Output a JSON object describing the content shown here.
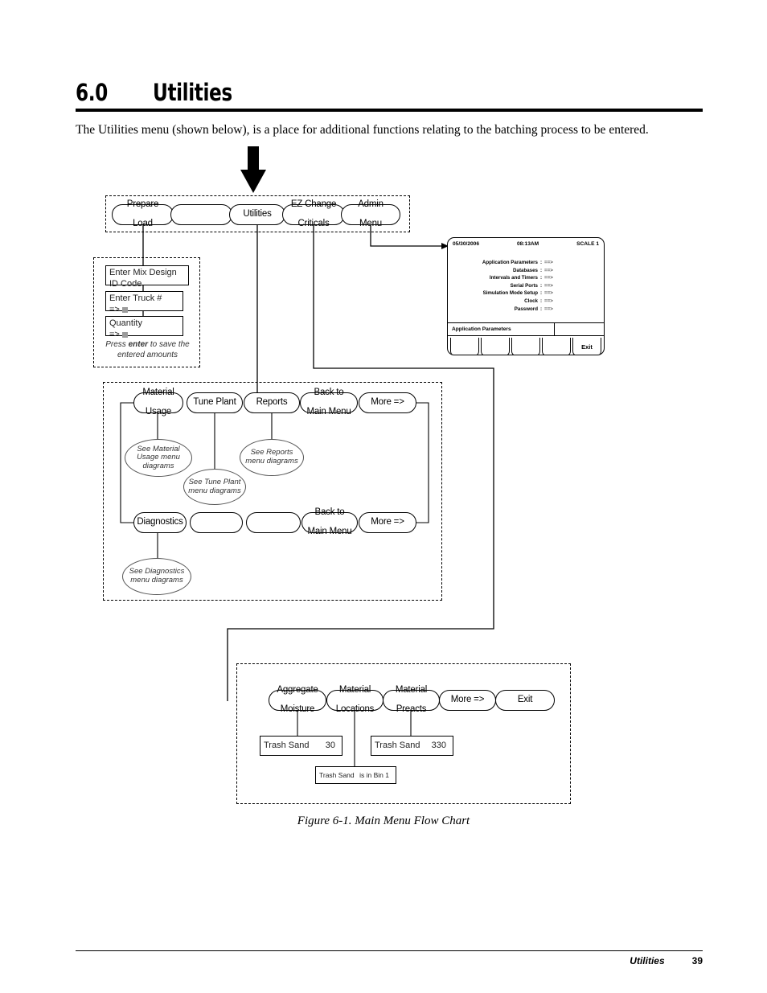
{
  "header": {
    "number": "6.0",
    "title": "Utilities",
    "intro": "The Utilities menu (shown below), is a place for additional functions relating to the batching process to be entered."
  },
  "flow": {
    "main_menu_row": [
      {
        "label_line1": "Prepare",
        "label_line2": "Load"
      },
      {
        "label_line1": "",
        "label_line2": ""
      },
      {
        "label_line1": "Utilities",
        "label_line2": ""
      },
      {
        "label_line1": "EZ Change",
        "label_line2": "Criticals"
      },
      {
        "label_line1": "Admin",
        "label_line2": "Menu"
      }
    ],
    "prepare_load_box": {
      "fields": [
        {
          "label": "Enter Mix Design ID Code",
          "prompt": "=>"
        },
        {
          "label": "Enter Truck #",
          "prompt": "=>"
        },
        {
          "label": "Quantity",
          "prompt": "=>"
        }
      ],
      "note_pre": "Press ",
      "note_bold": "enter",
      "note_post": " to save the",
      "note_line2": "entered amounts"
    },
    "utilities_row1": [
      {
        "label_line1": "Material",
        "label_line2": "Usage"
      },
      {
        "label_line1": "Tune Plant",
        "label_line2": ""
      },
      {
        "label_line1": "Reports",
        "label_line2": ""
      },
      {
        "label_line1": "Back to",
        "label_line2": "Main Menu"
      },
      {
        "label_line1": "More =>",
        "label_line2": ""
      }
    ],
    "utilities_row2": [
      {
        "label_line1": "Diagnostics",
        "label_line2": ""
      },
      {
        "label_line1": "",
        "label_line2": ""
      },
      {
        "label_line1": "",
        "label_line2": ""
      },
      {
        "label_line1": "Back to",
        "label_line2": "Main Menu"
      },
      {
        "label_line1": "More =>",
        "label_line2": ""
      }
    ],
    "notes": {
      "material_usage": "See Material Usage menu diagrams",
      "tune_plant": "See Tune Plant menu diagrams",
      "reports": "See Reports menu diagrams",
      "diagnostics": "See Diagnostics menu diagrams"
    },
    "ez_change_row": [
      {
        "label_line1": "Aggregate",
        "label_line2": "Moisture"
      },
      {
        "label_line1": "Material",
        "label_line2": "Locations"
      },
      {
        "label_line1": "Material",
        "label_line2": "Preacts"
      },
      {
        "label_line1": "More =>",
        "label_line2": ""
      },
      {
        "label_line1": "Exit",
        "label_line2": ""
      }
    ],
    "ez_change_boxes": {
      "aggregate_moisture": {
        "name": "Trash Sand",
        "value": "30"
      },
      "material_locations": {
        "name": "Trash Sand",
        "value": "is in Bin 1"
      },
      "material_preacts": {
        "name": "Trash Sand",
        "value": "330"
      }
    }
  },
  "lcd": {
    "date": "05/30/2006",
    "time": "08:13AM",
    "scale": "SCALE 1",
    "menu_items": [
      {
        "label": "Application Parameters",
        "colon": ":",
        "arrow": "==>"
      },
      {
        "label": "Databases",
        "colon": ":",
        "arrow": "==>"
      },
      {
        "label": "Intervals and Timers",
        "colon": ":",
        "arrow": "==>"
      },
      {
        "label": "Serial Ports",
        "colon": ":",
        "arrow": "==>"
      },
      {
        "label": "Simulation Mode Setup",
        "colon": ":",
        "arrow": "==>"
      },
      {
        "label": "Clock",
        "colon": ":",
        "arrow": "==>"
      },
      {
        "label": "Password",
        "colon": ":",
        "arrow": "==>"
      }
    ],
    "status_text": "Application Parameters",
    "softkeys": [
      "",
      "",
      "",
      "",
      "Exit"
    ]
  },
  "caption": "Figure 6-1. Main Menu Flow Chart",
  "footer": {
    "label": "Utilities",
    "page": "39"
  }
}
